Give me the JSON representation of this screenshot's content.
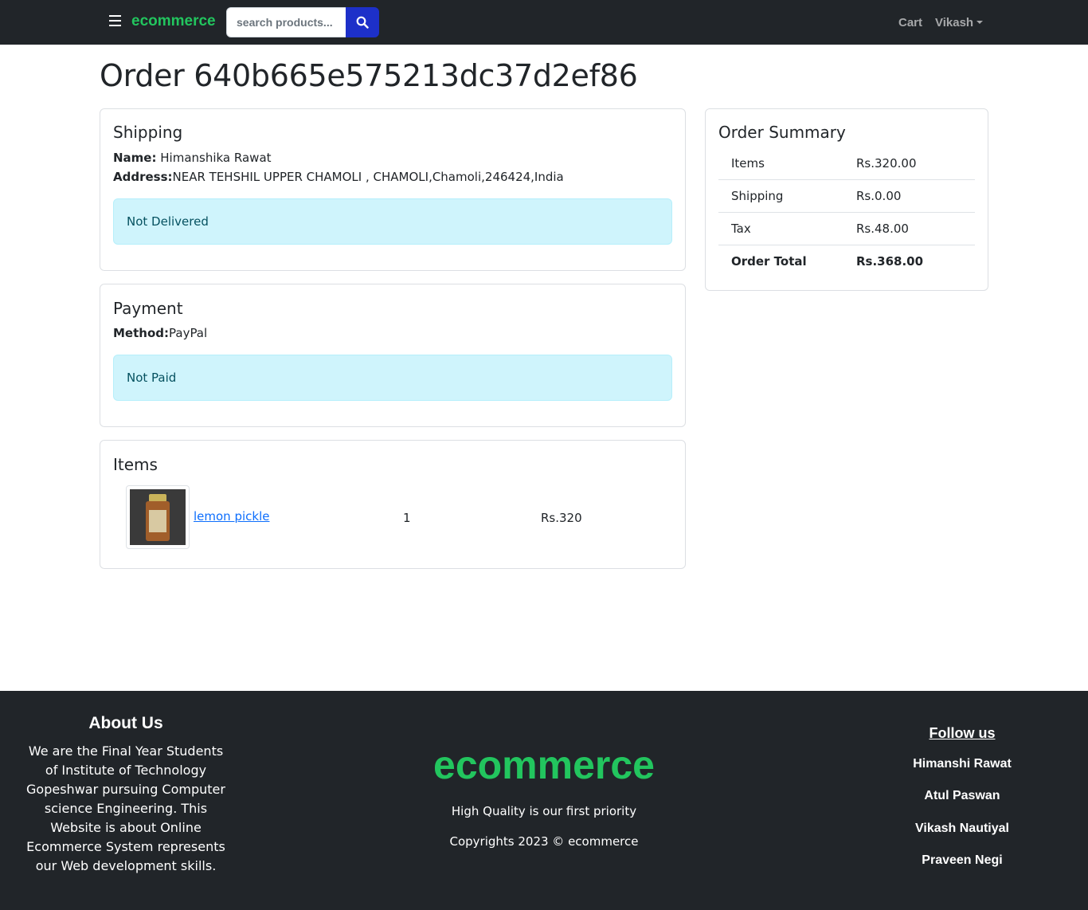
{
  "navbar": {
    "brand": "ecommerce",
    "search_placeholder": "search products...",
    "cart_label": "Cart",
    "user_label": "Vikash"
  },
  "order": {
    "title": "Order 640b665e575213dc37d2ef86"
  },
  "shipping": {
    "heading": "Shipping",
    "name_label": "Name:",
    "name_value": "Himanshika Rawat",
    "address_label": "Address:",
    "address_value": "NEAR TEHSHIL UPPER CHAMOLI , CHAMOLI,Chamoli,246424,India",
    "status": "Not Delivered"
  },
  "payment": {
    "heading": "Payment",
    "method_label": "Method:",
    "method_value": "PayPal",
    "status": "Not Paid"
  },
  "items": {
    "heading": "Items",
    "list": [
      {
        "name": "lemon pickle",
        "qty": "1",
        "price": "Rs.320"
      }
    ]
  },
  "summary": {
    "heading": "Order Summary",
    "rows": [
      {
        "label": "Items",
        "value": "Rs.320.00"
      },
      {
        "label": "Shipping",
        "value": "Rs.0.00"
      },
      {
        "label": "Tax",
        "value": "Rs.48.00"
      },
      {
        "label": "Order Total",
        "value": "Rs.368.00"
      }
    ]
  },
  "footer": {
    "about_title": "About Us",
    "about_text": "We are the Final Year Students of Institute of Technology Gopeshwar pursuing Computer science Engineering. This Website is about Online Ecommerce System represents our Web development skills.",
    "brand": "ecommerce",
    "tagline": "High Quality is our first priority",
    "copyright": "Copyrights 2023 © ecommerce",
    "follow_title": "Follow us",
    "members": [
      "Himanshi Rawat",
      "Atul Paswan",
      "Vikash Nautiyal",
      "Praveen Negi"
    ]
  },
  "colors": {
    "brand_green": "#22c55e",
    "navbar_bg": "#212529",
    "search_button": "#1d30c9",
    "alert_bg": "#cff4fc"
  }
}
